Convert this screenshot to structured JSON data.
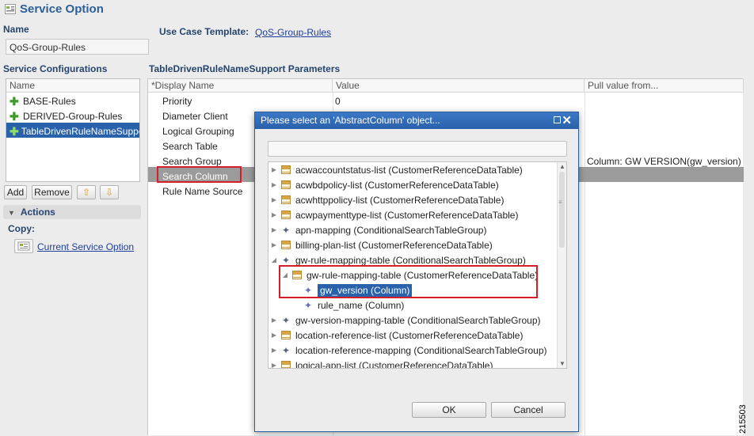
{
  "header": {
    "title": "Service Option",
    "icon": "service-option-icon"
  },
  "left": {
    "name_label": "Name",
    "name_value": "QoS-Group-Rules",
    "service_configurations_label": "Service Configurations",
    "list_header": "Name",
    "items": [
      {
        "label": "BASE-Rules",
        "selected": false
      },
      {
        "label": "DERIVED-Group-Rules",
        "selected": false
      },
      {
        "label": "TableDrivenRuleNameSupport",
        "selected": true
      }
    ],
    "buttons": {
      "add": "Add",
      "remove": "Remove",
      "up": "⇧",
      "down": "⇩"
    },
    "actions_title": "Actions",
    "copy_label": "Copy:",
    "current_service_option_link": "Current Service Option"
  },
  "right": {
    "use_case_label": "Use Case Template:",
    "use_case_link": "QoS-Group-Rules",
    "params_title": "TableDrivenRuleNameSupport Parameters",
    "columns": [
      "*Display Name",
      "Value",
      "Pull value from..."
    ],
    "rows": [
      {
        "name": "Priority",
        "value": "0",
        "pull": ""
      },
      {
        "name": "Diameter Client",
        "value": "",
        "pull": ""
      },
      {
        "name": "Logical Grouping",
        "value": "",
        "pull": ""
      },
      {
        "name": "Search Table",
        "value": "",
        "pull": ""
      },
      {
        "name": "Search Group",
        "value": "",
        "pull": "Column: GW VERSION(gw_version)"
      },
      {
        "name": "Search Column",
        "value": "",
        "pull": ""
      },
      {
        "name": "Rule Name Source",
        "value": "",
        "pull": ""
      }
    ]
  },
  "dialog": {
    "title": "Please select an 'AbstractColumn' object...",
    "filter_value": "",
    "tree": [
      {
        "text": "acwaccountstatus-list (CustomerReferenceDataTable)",
        "icon": "table",
        "level": 0,
        "arrow": "right"
      },
      {
        "text": "acwbdpolicy-list (CustomerReferenceDataTable)",
        "icon": "table",
        "level": 0,
        "arrow": "right"
      },
      {
        "text": "acwhttppolicy-list (CustomerReferenceDataTable)",
        "icon": "table",
        "level": 0,
        "arrow": "right"
      },
      {
        "text": "acwpaymenttype-list (CustomerReferenceDataTable)",
        "icon": "table",
        "level": 0,
        "arrow": "right"
      },
      {
        "text": "apn-mapping (ConditionalSearchTableGroup)",
        "icon": "group",
        "level": 0,
        "arrow": "right"
      },
      {
        "text": "billing-plan-list (CustomerReferenceDataTable)",
        "icon": "table",
        "level": 0,
        "arrow": "right"
      },
      {
        "text": "gw-rule-mapping-table (ConditionalSearchTableGroup)",
        "icon": "group",
        "level": 0,
        "arrow": "down"
      },
      {
        "text": "gw-rule-mapping-table (CustomerReferenceDataTable)",
        "icon": "table",
        "level": 1,
        "arrow": "down"
      },
      {
        "text": "gw_version (Column)",
        "icon": "column",
        "level": 2,
        "arrow": "",
        "selected": true
      },
      {
        "text": "rule_name (Column)",
        "icon": "column",
        "level": 2,
        "arrow": ""
      },
      {
        "text": "gw-version-mapping-table (ConditionalSearchTableGroup)",
        "icon": "group",
        "level": 0,
        "arrow": "right"
      },
      {
        "text": "location-reference-list (CustomerReferenceDataTable)",
        "icon": "table",
        "level": 0,
        "arrow": "right"
      },
      {
        "text": "location-reference-mapping (ConditionalSearchTableGroup)",
        "icon": "group",
        "level": 0,
        "arrow": "right"
      },
      {
        "text": "logical-apn-list (CustomerReferenceDataTable)",
        "icon": "table",
        "level": 0,
        "arrow": "right"
      }
    ],
    "ok": "OK",
    "cancel": "Cancel"
  },
  "figure_number": "215503",
  "colors": {
    "accent": "#2962ab",
    "title": "#2c5f97",
    "highlight": "#d21f2a"
  }
}
